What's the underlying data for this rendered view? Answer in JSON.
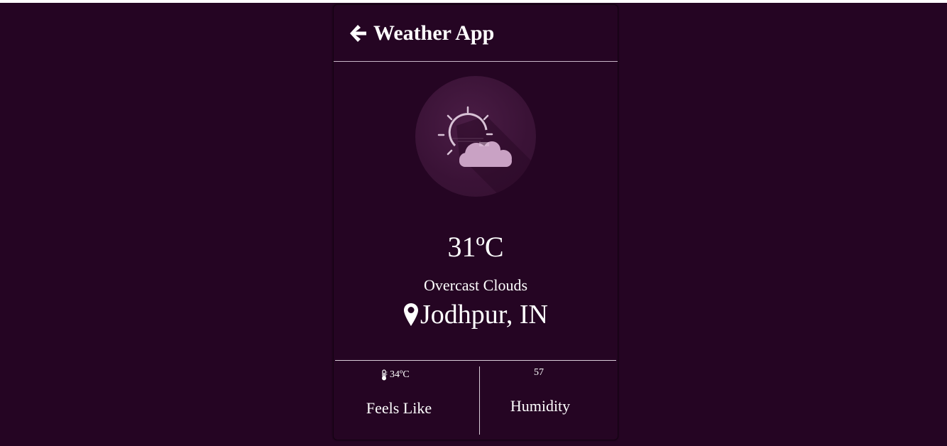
{
  "header": {
    "title": "Weather App",
    "back_icon": "arrow-left-icon"
  },
  "weather": {
    "icon": "partly-cloudy-icon",
    "temperature": "31ºC",
    "description": "Overcast Clouds",
    "location": "Jodhpur, IN",
    "location_icon": "map-pin-icon"
  },
  "stats": {
    "feels_like": {
      "value": "34ºC",
      "label": "Feels Like",
      "icon": "thermometer-icon"
    },
    "humidity": {
      "value": "57",
      "label": "Humidity"
    }
  },
  "colors": {
    "background": "#250523",
    "icon_circle": "#3a1236",
    "cloud": "#c9a2c4",
    "text": "#ffffff"
  }
}
